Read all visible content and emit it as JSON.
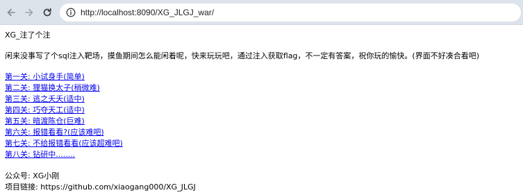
{
  "browser": {
    "back_icon": "arrow-left-icon",
    "forward_icon": "arrow-right-icon",
    "reload_icon": "reload-icon",
    "info_icon": "info-icon",
    "url": "http://localhost:8090/XG_JLGJ_war/"
  },
  "page": {
    "title": "XG_注了个注",
    "intro": "闲来没事写了个sql注入靶场，摸鱼期间怎么能闲着呢，快来玩玩吧，通过注入获取flag，不一定有答案，祝你玩的愉快。(界面不好凑合看吧)",
    "levels": [
      {
        "label": "第一关: 小试身手(简单)"
      },
      {
        "label": "第二关: 狸猫换太子(稍微难)"
      },
      {
        "label": "第三关: 逃之夭夭(适中)"
      },
      {
        "label": "第四关: 巧夺天工(适中)"
      },
      {
        "label": "第五关: 暗渡陈仓(巨难)"
      },
      {
        "label": "第六关: 报错看看?(应该难吧)"
      },
      {
        "label": "第七关: 不给报错看看(应该超难吧)"
      },
      {
        "label": "第八关: 钻研中........"
      }
    ],
    "footer": {
      "wechat": "公众号: XG小刚",
      "project": "项目链接: https://github.com/xiaogang000/XG_JLGJ"
    }
  }
}
